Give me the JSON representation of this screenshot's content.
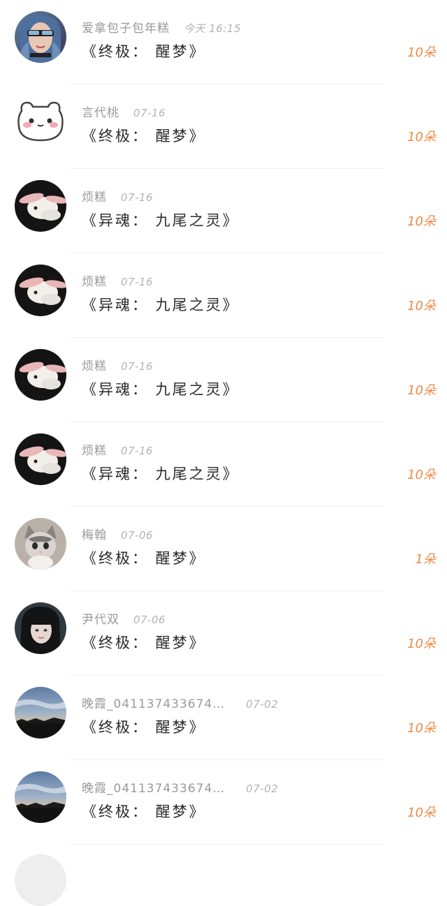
{
  "gift_records": [
    {
      "nickname": "爱拿包子包年糕",
      "time": "今天 16:15",
      "title": "《终极： 醒梦》",
      "gift": "10朵",
      "avatar": "sunglasses-woman-avatar"
    },
    {
      "nickname": "言代桃",
      "time": "07-16",
      "title": "《终极： 醒梦》",
      "gift": "10朵",
      "avatar": "cartoon-bear-avatar"
    },
    {
      "nickname": "烦糕",
      "time": "07-16",
      "title": "《异魂： 九尾之灵》",
      "gift": "10朵",
      "avatar": "rabbit-avatar"
    },
    {
      "nickname": "烦糕",
      "time": "07-16",
      "title": "《异魂： 九尾之灵》",
      "gift": "10朵",
      "avatar": "rabbit-avatar"
    },
    {
      "nickname": "烦糕",
      "time": "07-16",
      "title": "《异魂： 九尾之灵》",
      "gift": "10朵",
      "avatar": "rabbit-avatar"
    },
    {
      "nickname": "烦糕",
      "time": "07-16",
      "title": "《异魂： 九尾之灵》",
      "gift": "10朵",
      "avatar": "rabbit-avatar"
    },
    {
      "nickname": "梅翰",
      "time": "07-06",
      "title": "《终极： 醒梦》",
      "gift": "1朵",
      "avatar": "kitten-avatar"
    },
    {
      "nickname": "尹代双",
      "time": "07-06",
      "title": "《终极： 醒梦》",
      "gift": "10朵",
      "avatar": "dark-hair-woman-avatar"
    },
    {
      "nickname": "晚霞_041137433674…",
      "time": "07-02",
      "title": "《终极： 醒梦》",
      "gift": "10朵",
      "avatar": "dusk-sky-avatar"
    },
    {
      "nickname": "晚霞_041137433674…",
      "time": "07-02",
      "title": "《终极： 醒梦》",
      "gift": "10朵",
      "avatar": "dusk-sky-avatar"
    }
  ],
  "colors": {
    "gift_accent": "#f08a45",
    "nickname": "#9a9a9a",
    "time": "#b4b4b4",
    "title": "#2a2a2a",
    "divider": "#f0f0f0"
  }
}
